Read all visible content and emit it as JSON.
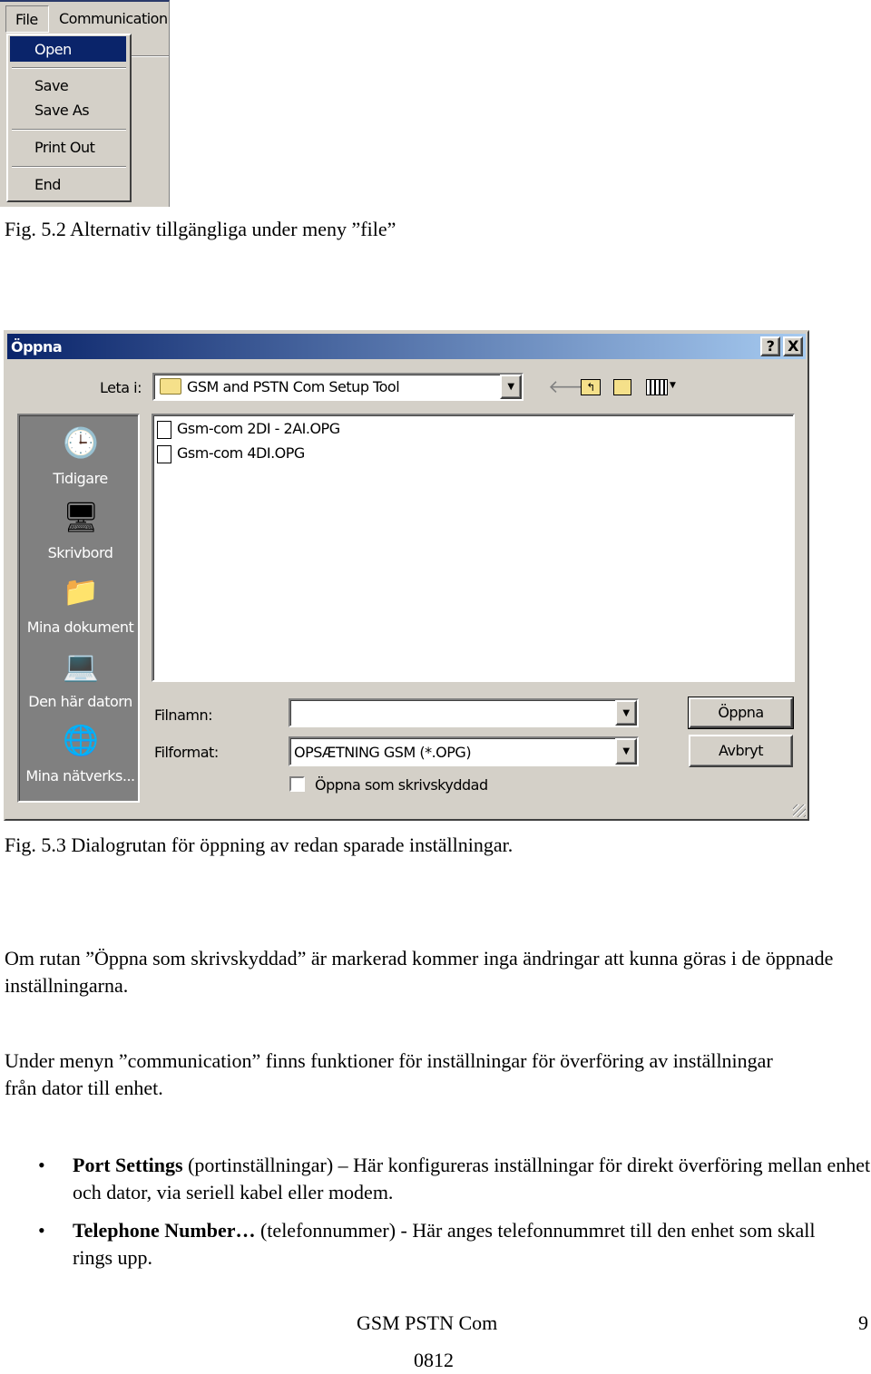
{
  "menu_screenshot": {
    "menubar": [
      "File",
      "Communication"
    ],
    "items": [
      "Open",
      "Save",
      "Save As",
      "Print Out",
      "End"
    ],
    "highlight_color": "#0a246a"
  },
  "caption1": "Fig. 5.2 Alternativ tillgängliga under meny ”file”",
  "dialog": {
    "title": "Öppna",
    "help_label": "?",
    "close_label": "X",
    "look_in_label": "Leta i:",
    "look_in_value": "GSM and PSTN Com Setup Tool",
    "places": [
      "Tidigare",
      "Skrivbord",
      "Mina dokument",
      "Den här datorn",
      "Mina nätverks..."
    ],
    "files": [
      "Gsm-com 2DI - 2AI.OPG",
      "Gsm-com 4DI.OPG"
    ],
    "filename_label": "Filnamn:",
    "filename_value": "",
    "format_label": "Filformat:",
    "format_value": "OPSÆTNING GSM (*.OPG)",
    "readonly_label": "Öppna som skrivskyddad",
    "readonly_checked": false,
    "open_button": "Öppna",
    "cancel_button": "Avbryt"
  },
  "caption2": "Fig. 5.3 Dialogrutan för öppning av redan sparade inställningar.",
  "para1": "Om rutan ”Öppna som skrivskyddad” är markerad kommer inga ändringar att kunna göras i de öppnade inställningarna.",
  "para2": "Under menyn ”communication” finns funktioner för inställningar för överföring av inställningar från dator till enhet.",
  "bullets": [
    {
      "bold": "Port Settings",
      "text": " (portinställningar) – Här konfigureras inställningar för direkt överföring mellan enhet och dator, via seriell kabel eller modem."
    },
    {
      "bold": "Telephone Number…",
      "text": " (telefonnummer) - Här anges telefonnummret till den enhet som skall rings upp."
    }
  ],
  "footer": {
    "title": "GSM PSTN Com",
    "date": "0812",
    "page": "9"
  }
}
